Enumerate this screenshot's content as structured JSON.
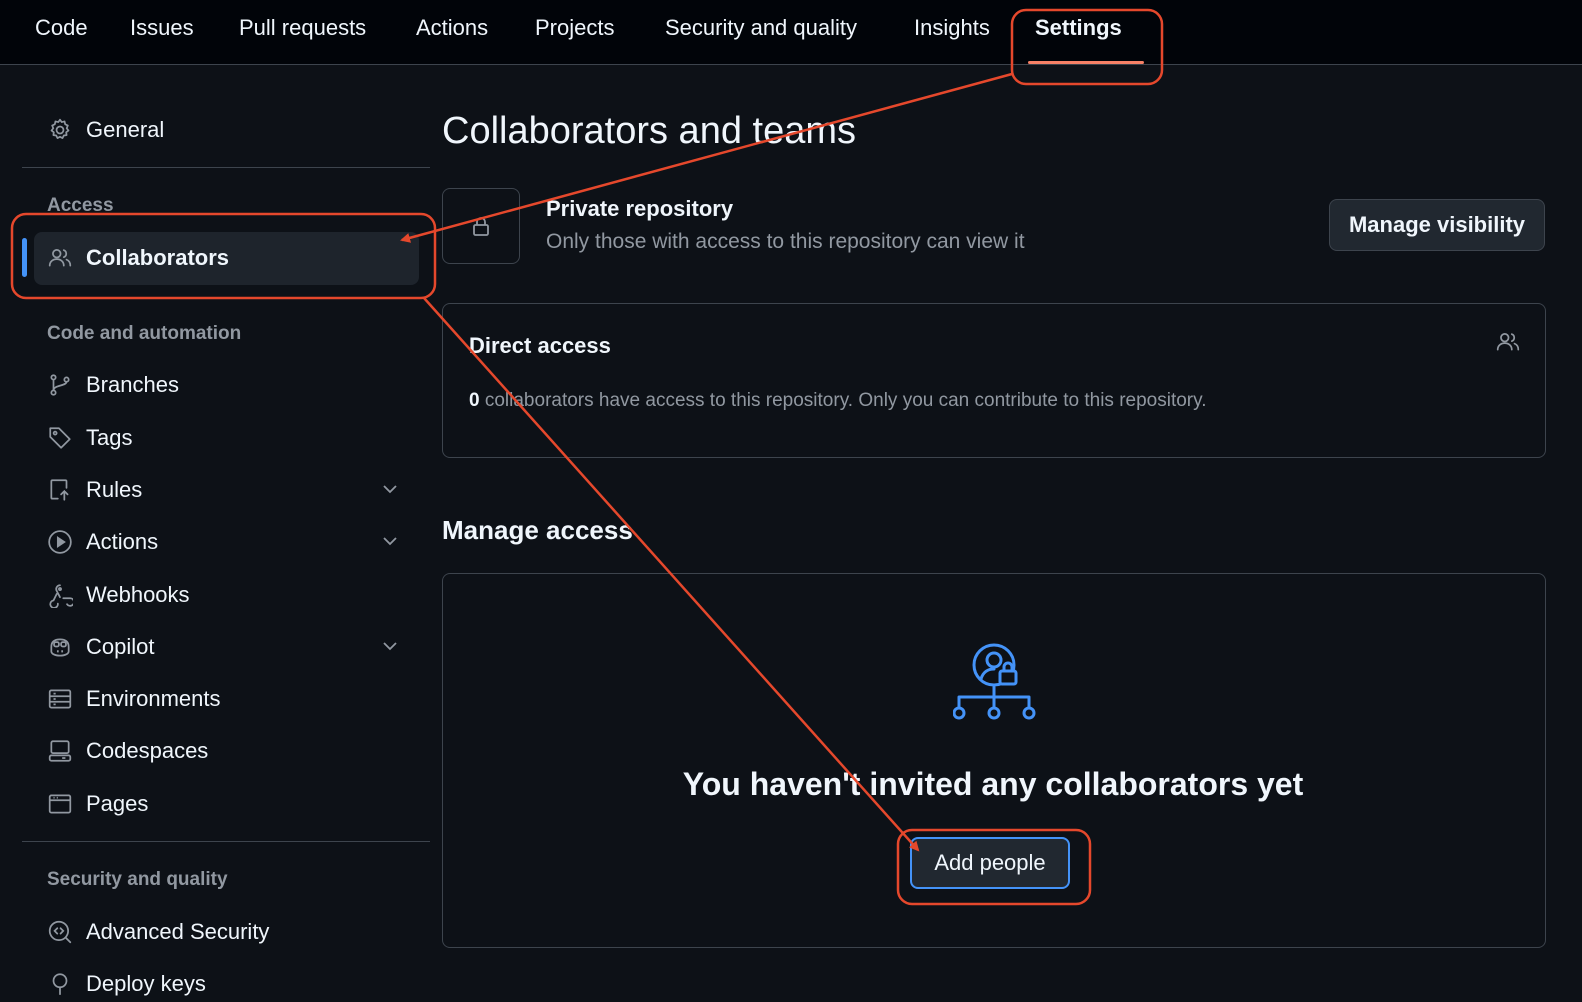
{
  "topnav": {
    "tabs": [
      {
        "label": "Code"
      },
      {
        "label": "Issues"
      },
      {
        "label": "Pull requests"
      },
      {
        "label": "Actions"
      },
      {
        "label": "Projects"
      },
      {
        "label": "Security and quality"
      },
      {
        "label": "Insights"
      },
      {
        "label": "Settings",
        "active": true
      }
    ]
  },
  "sidebar": {
    "general": {
      "label": "General",
      "icon": "gear-icon"
    },
    "sections": [
      {
        "heading": "Access",
        "items": [
          {
            "label": "Collaborators",
            "icon": "people-icon",
            "selected": true
          }
        ]
      },
      {
        "heading": "Code and automation",
        "items": [
          {
            "label": "Branches",
            "icon": "git-branch-icon"
          },
          {
            "label": "Tags",
            "icon": "tag-icon"
          },
          {
            "label": "Rules",
            "icon": "rules-icon",
            "expandable": true
          },
          {
            "label": "Actions",
            "icon": "play-icon",
            "expandable": true
          },
          {
            "label": "Webhooks",
            "icon": "webhook-icon"
          },
          {
            "label": "Copilot",
            "icon": "copilot-icon",
            "expandable": true
          },
          {
            "label": "Environments",
            "icon": "server-icon"
          },
          {
            "label": "Codespaces",
            "icon": "codespaces-icon"
          },
          {
            "label": "Pages",
            "icon": "browser-icon"
          }
        ]
      },
      {
        "heading": "Security and quality",
        "items": [
          {
            "label": "Advanced Security",
            "icon": "codescan-icon"
          },
          {
            "label": "Deploy keys",
            "icon": "key-icon"
          }
        ]
      }
    ]
  },
  "main": {
    "title": "Collaborators and teams",
    "visibility": {
      "title": "Private repository",
      "description": "Only those with access to this repository can view it",
      "button": "Manage visibility"
    },
    "direct_access": {
      "title": "Direct access",
      "count": "0",
      "description": " collaborators have access to this repository. Only you can contribute to this repository."
    },
    "manage_access": {
      "title": "Manage access",
      "empty_message": "You haven't invited any collaborators yet",
      "button": "Add people"
    }
  },
  "annotations": {
    "color": "#e5482c"
  },
  "colors": {
    "accent": "#4493f8",
    "underline": "#f78166",
    "background": "#0d1117"
  }
}
